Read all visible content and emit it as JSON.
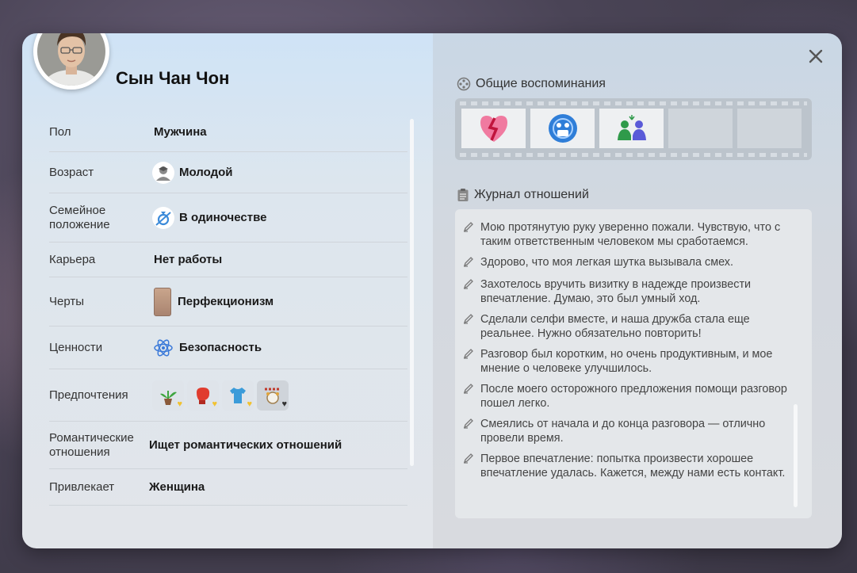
{
  "character": {
    "name": "Сын Чан Чон"
  },
  "details": [
    {
      "label": "Пол",
      "value": "Мужчина",
      "icon": ""
    },
    {
      "label": "Возраст",
      "value": "Молодой",
      "icon": "young-adult-icon"
    },
    {
      "label": "Семейное положение",
      "value": "В одиночестве",
      "icon": "single-icon"
    },
    {
      "label": "Карьера",
      "value": "Нет работы",
      "icon": ""
    },
    {
      "label": "Черты",
      "value": "Перфекционизм",
      "icon": "trait-card-icon"
    },
    {
      "label": "Ценности",
      "value": "Безопасность",
      "icon": "atom-icon"
    },
    {
      "label": "Предпочтения",
      "value": "",
      "icon": "preferences"
    },
    {
      "label": "Романтические отношения",
      "value": "Ищет романтических отношений",
      "icon": ""
    },
    {
      "label": "Привлекает",
      "value": "Женщина",
      "icon": ""
    }
  ],
  "preferences": [
    "plant-icon",
    "boxing-glove-icon",
    "tshirt-icon",
    "party-icon"
  ],
  "memories": {
    "title": "Общие воспоминания",
    "slots": [
      "broken-heart-icon",
      "selfie-icon",
      "high-five-icon",
      "",
      ""
    ]
  },
  "journal": {
    "title": "Журнал отношений",
    "entries": [
      "Мою протянутую руку уверенно пожали. Чувствую, что с таким ответственным человеком мы сработаемся.",
      "Здорово, что моя легкая шутка вызывала смех.",
      "Захотелось вручить визитку в надежде произвести впечатление. Думаю, это был умный ход.",
      "Сделали селфи вместе, и наша дружба стала еще реальнее. Нужно обязательно повторить!",
      "Разговор был коротким, но очень продуктивным, и мое мнение о человеке улучшилось.",
      "После моего осторожного предложения помощи разговор пошел легко.",
      "Смеялись от начала и до конца разговора — отлично провели время.",
      "Первое впечатление: попытка произвести хорошее впечатление удалась. Кажется, между нами есть контакт."
    ]
  },
  "colors": {
    "accent_heart": "#e0245e",
    "pref_heart": "#f1c232"
  }
}
